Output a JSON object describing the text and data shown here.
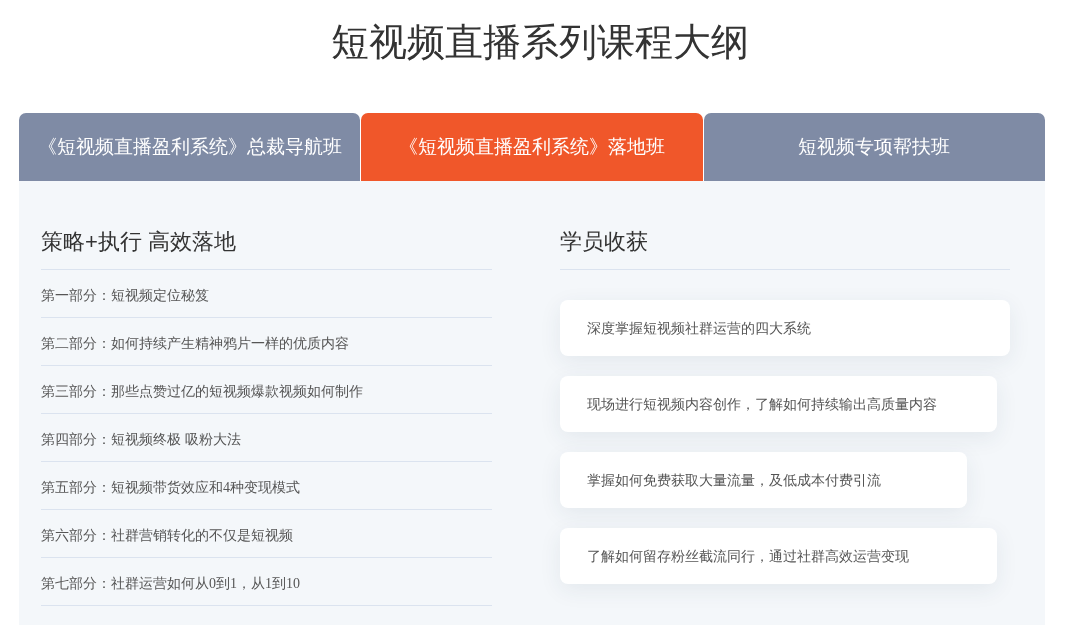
{
  "title": "短视频直播系列课程大纲",
  "tabs": [
    {
      "label": "《短视频直播盈利系统》总裁导航班",
      "selected": false
    },
    {
      "label": "《短视频直播盈利系统》落地班",
      "selected": true
    },
    {
      "label": "短视频专项帮扶班",
      "selected": false
    }
  ],
  "outline": {
    "heading": "策略+执行 高效落地",
    "items": [
      "第一部分：短视频定位秘笈",
      "第二部分：如何持续产生精神鸦片一样的优质内容",
      "第三部分：那些点赞过亿的短视频爆款视频如何制作",
      "第四部分：短视频终极 吸粉大法",
      "第五部分：短视频带货效应和4种变现模式",
      "第六部分：社群营销转化的不仅是短视频",
      "第七部分：社群运营如何从0到1，从1到10"
    ]
  },
  "outcomes": {
    "heading": "学员收获",
    "items": [
      "深度掌握短视频社群运营的四大系统",
      "现场进行短视频内容创作，了解如何持续输出高质量内容",
      "掌握如何免费获取大量流量，及低成本付费引流",
      "了解如何留存粉丝截流同行，通过社群高效运营变现"
    ]
  }
}
